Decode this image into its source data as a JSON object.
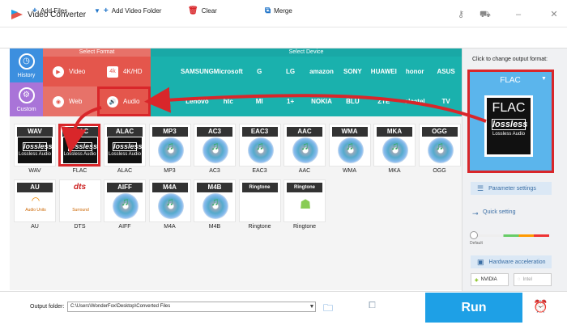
{
  "app": {
    "title": "Video Converter"
  },
  "toolbar": {
    "add_files": "Add Files",
    "add_video_folder": "Add Video Folder",
    "clear": "Clear",
    "merge": "Merge"
  },
  "side": {
    "history": "History",
    "custom": "Custom"
  },
  "sections": {
    "select_format": "Select Format",
    "select_device": "Select Device"
  },
  "format_tabs": {
    "video": "Video",
    "k4": "4K/HD",
    "web": "Web",
    "audio": "Audio"
  },
  "devices": {
    "row1": [
      "",
      "SAMSUNG",
      "Microsoft",
      "G",
      "LG",
      "amazon",
      "SONY",
      "HUAWEI",
      "honor",
      "ASUS"
    ],
    "row2": [
      "",
      "Lenovo",
      "htc",
      "MI",
      "1+",
      "NOKIA",
      "BLU",
      "ZTE",
      "alcatel",
      "TV"
    ]
  },
  "formats": [
    {
      "tag": "WAV",
      "label": "WAV"
    },
    {
      "tag": "FLAC",
      "label": "FLAC"
    },
    {
      "tag": "ALAC",
      "label": "ALAC"
    },
    {
      "tag": "MP3",
      "label": "MP3"
    },
    {
      "tag": "AC3",
      "label": "AC3"
    },
    {
      "tag": "EAC3",
      "label": "EAC3"
    },
    {
      "tag": "AAC",
      "label": "AAC"
    },
    {
      "tag": "WMA",
      "label": "WMA"
    },
    {
      "tag": "MKA",
      "label": "MKA"
    },
    {
      "tag": "OGG",
      "label": "OGG"
    },
    {
      "tag": "AU",
      "label": "AU"
    },
    {
      "tag": "dts",
      "label": "DTS"
    },
    {
      "tag": "AIFF",
      "label": "AIFF"
    },
    {
      "tag": "M4A",
      "label": "M4A"
    },
    {
      "tag": "M4B",
      "label": "M4B"
    },
    {
      "tag": "Ringtone",
      "label": "Ringtone"
    },
    {
      "tag": "Ringtone",
      "label": "Ringtone"
    }
  ],
  "lossless": {
    "word": "lossless",
    "sub": "Lossless Audio"
  },
  "au_sub": "Audio Units",
  "dts_sub": "Surround",
  "right": {
    "hint": "Click to change output format:",
    "selected_format": "FLAC",
    "param_settings": "Parameter settings",
    "quick_setting": "Quick setting",
    "default": "Default",
    "hw_accel": "Hardware acceleration",
    "nvidia": "NVIDIA",
    "intel": "Intel"
  },
  "bottom": {
    "output_label": "Output folder:",
    "output_path": "C:\\Users\\WonderFox\\Desktop\\Converted Files",
    "run": "Run"
  },
  "colors": {
    "red": "#d9262a",
    "teal": "#1ab1ad",
    "coral": "#e4564c",
    "blue": "#1ea0e6",
    "purple": "#a974d8"
  }
}
